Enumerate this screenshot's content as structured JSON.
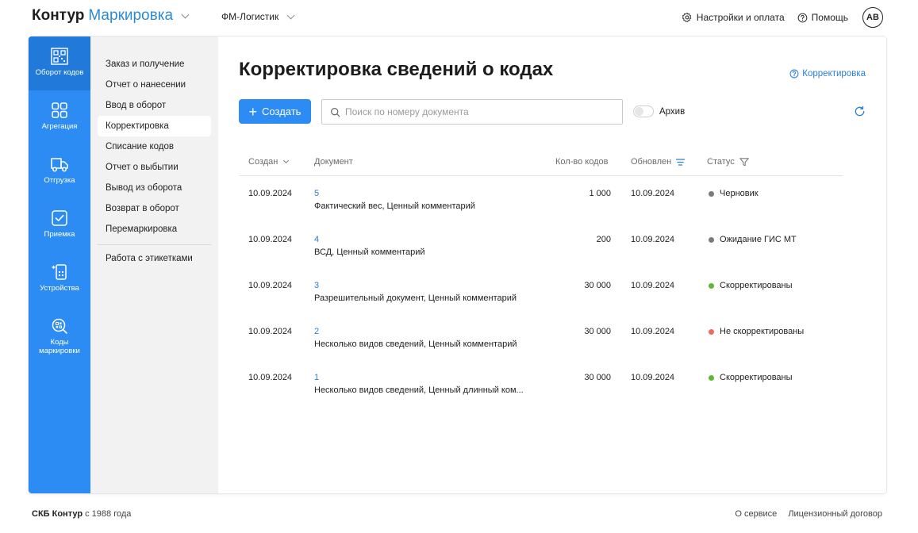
{
  "header": {
    "brand_main": "Контур",
    "brand_product": "Маркировка",
    "org": "ФМ-Логистик",
    "settings_label": "Настройки и оплата",
    "help_label": "Помощь",
    "avatar_initials": "АВ"
  },
  "rail": {
    "items": [
      {
        "label": "Оборот кодов",
        "icon": "qr-code-icon"
      },
      {
        "label": "Агрегация",
        "icon": "grid-icon"
      },
      {
        "label": "Отгрузка",
        "icon": "truck-icon"
      },
      {
        "label": "Приемка",
        "icon": "check-box-icon"
      },
      {
        "label": "Устройства",
        "icon": "scanner-device-icon"
      },
      {
        "label_line1": "Коды",
        "label_line2": "маркировки",
        "icon": "search-code-icon"
      }
    ]
  },
  "subnav": {
    "items": [
      "Заказ и получение",
      "Отчет о нанесении",
      "Ввод в оборот",
      "Корректировка",
      "Списание кодов",
      "Отчет о выбытии",
      "Вывод из оборота",
      "Возврат в оборот",
      "Перемаркировка"
    ],
    "extra": "Работа с этикетками"
  },
  "main": {
    "title": "Корректировка сведений о кодах",
    "help_link": "Корректировка",
    "create_label": "Создать",
    "search_placeholder": "Поиск по номеру документа",
    "archive_label": "Архив"
  },
  "table": {
    "columns": {
      "created": "Создан",
      "document": "Документ",
      "count": "Кол-во кодов",
      "updated": "Обновлен",
      "status": "Статус"
    },
    "rows": [
      {
        "created": "10.09.2024",
        "number": "5",
        "desc": "Фактический вес, Ценный комментарий",
        "count": "1 000",
        "updated": "10.09.2024",
        "status": "Черновик",
        "status_color": "#7a7a7a"
      },
      {
        "created": "10.09.2024",
        "number": "4",
        "desc": "ВСД, Ценный комментарий",
        "count": "200",
        "updated": "10.09.2024",
        "status": "Ожидание ГИС МТ",
        "status_color": "#7a7a7a"
      },
      {
        "created": "10.09.2024",
        "number": "3",
        "desc": "Разрешительный документ, Ценный комментарий",
        "count": "30 000",
        "updated": "10.09.2024",
        "status": "Скорректированы",
        "status_color": "#5fb832"
      },
      {
        "created": "10.09.2024",
        "number": "2",
        "desc": "Несколько видов сведений, Ценный комментарий",
        "count": "30 000",
        "updated": "10.09.2024",
        "status": "Не скорректированы",
        "status_color": "#ee6a5b"
      },
      {
        "created": "10.09.2024",
        "number": "1",
        "desc": "Несколько видов сведений, Ценный длинный ком...",
        "count": "30 000",
        "updated": "10.09.2024",
        "status": "Скорректированы",
        "status_color": "#5fb832"
      }
    ]
  },
  "footer": {
    "company": "СКБ Контур",
    "since": "с 1988 года",
    "about": "О сервисе",
    "license": "Лицензионный договор"
  }
}
